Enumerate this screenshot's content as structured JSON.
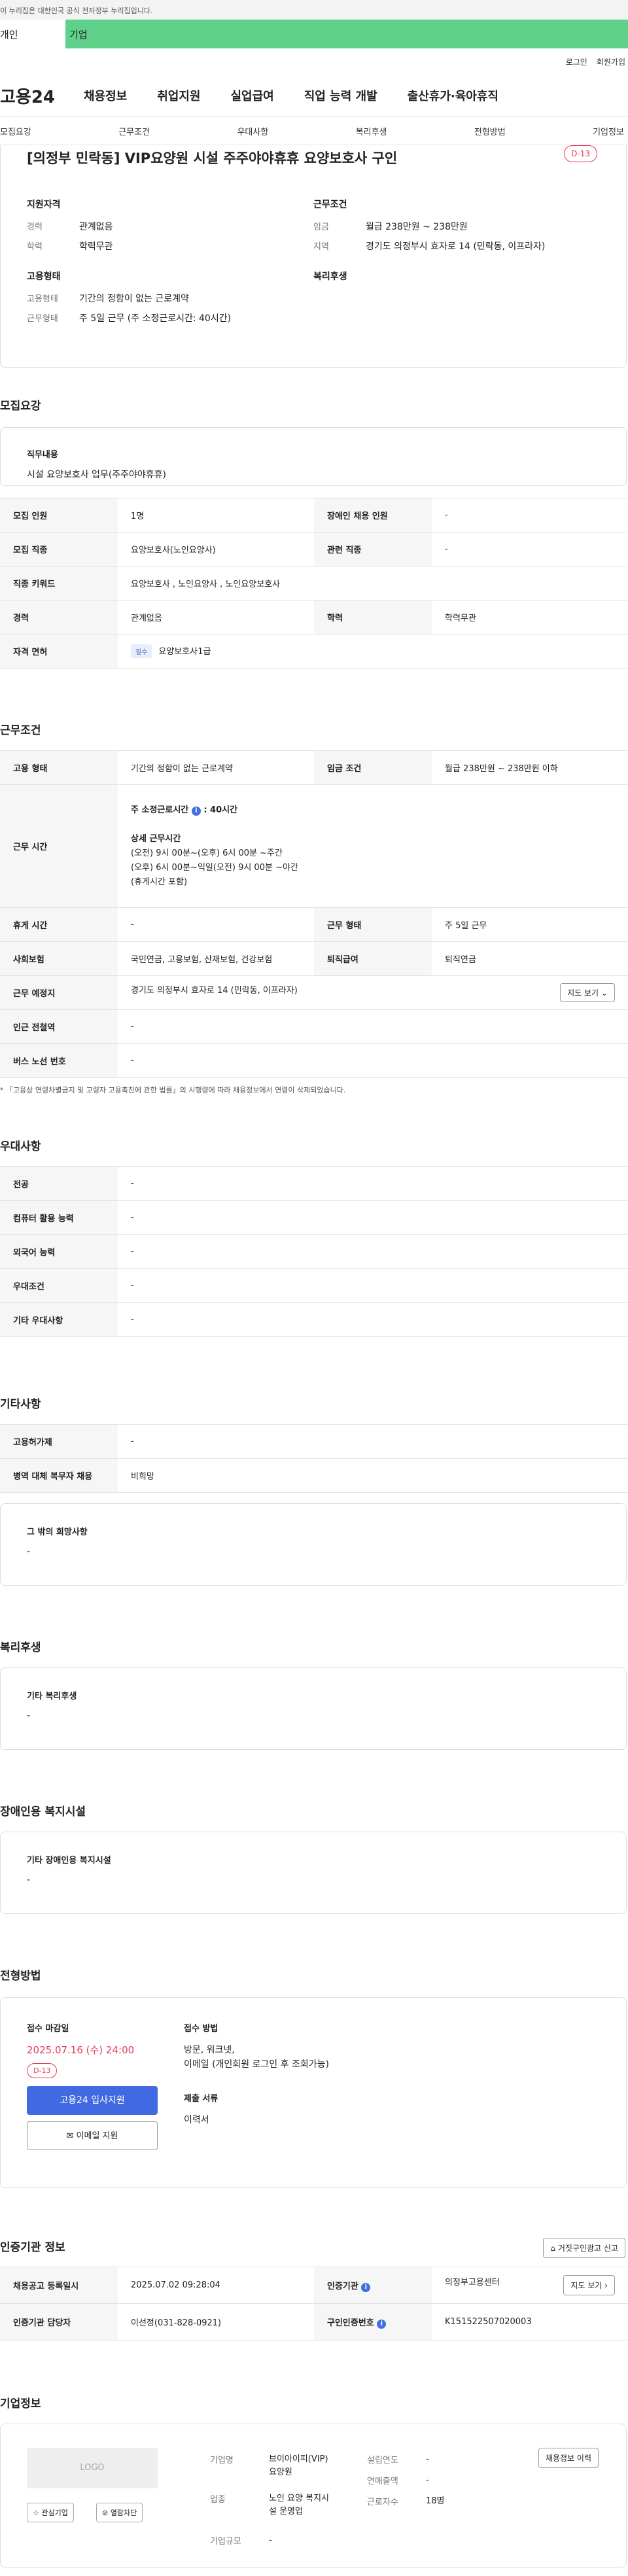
{
  "gov_banner": "이 누리집은 대한민국 공식 전자정부 누리집입니다.",
  "user_tabs": {
    "personal": "개인",
    "company": "기업"
  },
  "util": {
    "login": "로그인",
    "join": "회원가입"
  },
  "logo": "고용24",
  "gnb": [
    "채용정보",
    "취업지원",
    "실업급여",
    "직업 능력 개발",
    "출산휴가·육아휴직"
  ],
  "subnav": [
    "모집요강",
    "근무조건",
    "우대사항",
    "복리후생",
    "전형방법",
    "기업정보"
  ],
  "job": {
    "title": "[의정부 민락동] VIP요양원 시설 주주야야휴휴 요양보호사 구인",
    "dday": "D-13",
    "qual_head": "지원자격",
    "career_k": "경력",
    "career_v": "관계없음",
    "edu_k": "학력",
    "edu_v": "학력무관",
    "emp_head": "고용형태",
    "emp_k": "고용형태",
    "emp_v": "기간의 정함이 없는 근로계약",
    "worktype_k": "근무형태",
    "worktype_v": "주 5일 근무 (주 소정근로시간: 40시간)",
    "cond_head": "근무조건",
    "wage_k": "임금",
    "wage_v": "월급 238만원 ~ 238만원",
    "area_k": "지역",
    "area_v": "경기도 의정부시 효자로 14 (민락동, 이프라자)",
    "welfare_head": "복리후생"
  },
  "req": {
    "title": "모집요강",
    "duty_label": "직무내용",
    "duty_value": "시설 요양보호사 업무(주주야야휴휴)",
    "rows": {
      "headcount_k": "모집 인원",
      "headcount_v": "1명",
      "disabled_k": "장애인 채용 인원",
      "disabled_v": "-",
      "job_k": "모집 직종",
      "job_v": "요양보호사(노인요양사)",
      "related_k": "관련 직종",
      "related_v": "-",
      "keyword_k": "직종 키워드",
      "keyword_v": "요양보호사 , 노인요양사 , 노인요양보호사",
      "career_k": "경력",
      "career_v": "관계없음",
      "edu_k": "학력",
      "edu_v": "학력무관",
      "license_k": "자격 면허",
      "license_badge": "필수",
      "license_v": "요양보호사1급"
    }
  },
  "work": {
    "title": "근무조건",
    "emp_k": "고용 형태",
    "emp_v": "기간의 정함이 없는 근로계약",
    "wage_k": "임금 조건",
    "wage_v": "월급 238만원 ~ 238만원 이하",
    "hours_k": "근무 시간",
    "hours_main": "주 소정근로시간",
    "hours_main_v": ": 40시간",
    "hours_detail_head": "상세 근무시간",
    "hours_detail": [
      "(오전) 9시 00분~(오후) 6시 00분 ~주간",
      "(오후) 6시 00분~익일(오전) 9시 00분 ~야간",
      "(휴게시간 포함)"
    ],
    "rest_k": "휴게 시간",
    "rest_v": "-",
    "worktype_k": "근무 형태",
    "worktype_v": "주 5일 근무",
    "insurance_k": "사회보험",
    "insurance_v": "국민연금, 고용보험, 산재보험, 건강보험",
    "retire_k": "퇴직급여",
    "retire_v": "퇴직연금",
    "place_k": "근무 예정지",
    "place_v": "경기도 의정부시 효자로 14 (민락동, 이프라자)",
    "map_btn": "지도 보기",
    "station_k": "인근 전철역",
    "station_v": "-",
    "bus_k": "버스 노선 번호",
    "bus_v": "-",
    "note": "* 「고용상 연령차별금지 및 고령자 고용촉진에 관한 법률」의 시행령에 따라 채용정보에서 연령이 삭제되었습니다."
  },
  "pref": {
    "title": "우대사항",
    "rows": [
      {
        "k": "전공",
        "v": "-"
      },
      {
        "k": "컴퓨터 활용 능력",
        "v": "-"
      },
      {
        "k": "외국어 능력",
        "v": "-"
      },
      {
        "k": "우대조건",
        "v": "-"
      },
      {
        "k": "기타 우대사항",
        "v": "-"
      }
    ]
  },
  "etc": {
    "title": "기타사항",
    "rows": [
      {
        "k": "고용허가제",
        "v": "-"
      },
      {
        "k": "병역 대체 복무자 채용",
        "v": "비희망"
      }
    ],
    "other_label": "그 밖의 희망사항",
    "other_value": "-"
  },
  "welfare": {
    "title": "복리후생",
    "label": "기타 복리후생",
    "value": "-"
  },
  "disabled_fac": {
    "title": "장애인용 복지시설",
    "label": "기타 장애인용 복지시설",
    "value": "-"
  },
  "apply": {
    "title": "전형방법",
    "deadline_label": "접수 마감일",
    "deadline": "2025.07.16 (수) 24:00",
    "dday": "D-13",
    "apply_btn": "고용24 입사지원",
    "mail_btn": "이메일 지원",
    "method_label": "접수 방법",
    "method_v1": "방문, 워크넷,",
    "method_v2": "이메일 (개인회원 로그인 후 조회가능)",
    "docs_label": "제출 서류",
    "docs_v": "이력서"
  },
  "agency": {
    "title": "인증기관 정보",
    "report_btn": "거짓구인광고 신고",
    "date_k": "채용공고 등록일시",
    "date_v": "2025.07.02 09:28:04",
    "org_k": "인증기관",
    "org_v": "의정부고용센터",
    "map_btn": "지도 보기",
    "manager_k": "인증기관 담당자",
    "manager_v": "이선정(031-828-0921)",
    "num_k": "구인인증번호",
    "num_v": "K151522507020003"
  },
  "company": {
    "title": "기업정보",
    "logo": "LOGO",
    "fav_btn": "관심기업",
    "block_btn": "열람차단",
    "name_k": "기업명",
    "name_v": "브이아이피(VIP)요양원",
    "biz_k": "업종",
    "biz_v": "노인 요양 복지시설 운영업",
    "size_k": "기업규모",
    "size_v": "-",
    "year_k": "설립연도",
    "year_v": "-",
    "sales_k": "연매출액",
    "sales_v": "-",
    "emp_k": "근로자수",
    "emp_v": "18명",
    "history_btn": "채용정보 이력"
  }
}
